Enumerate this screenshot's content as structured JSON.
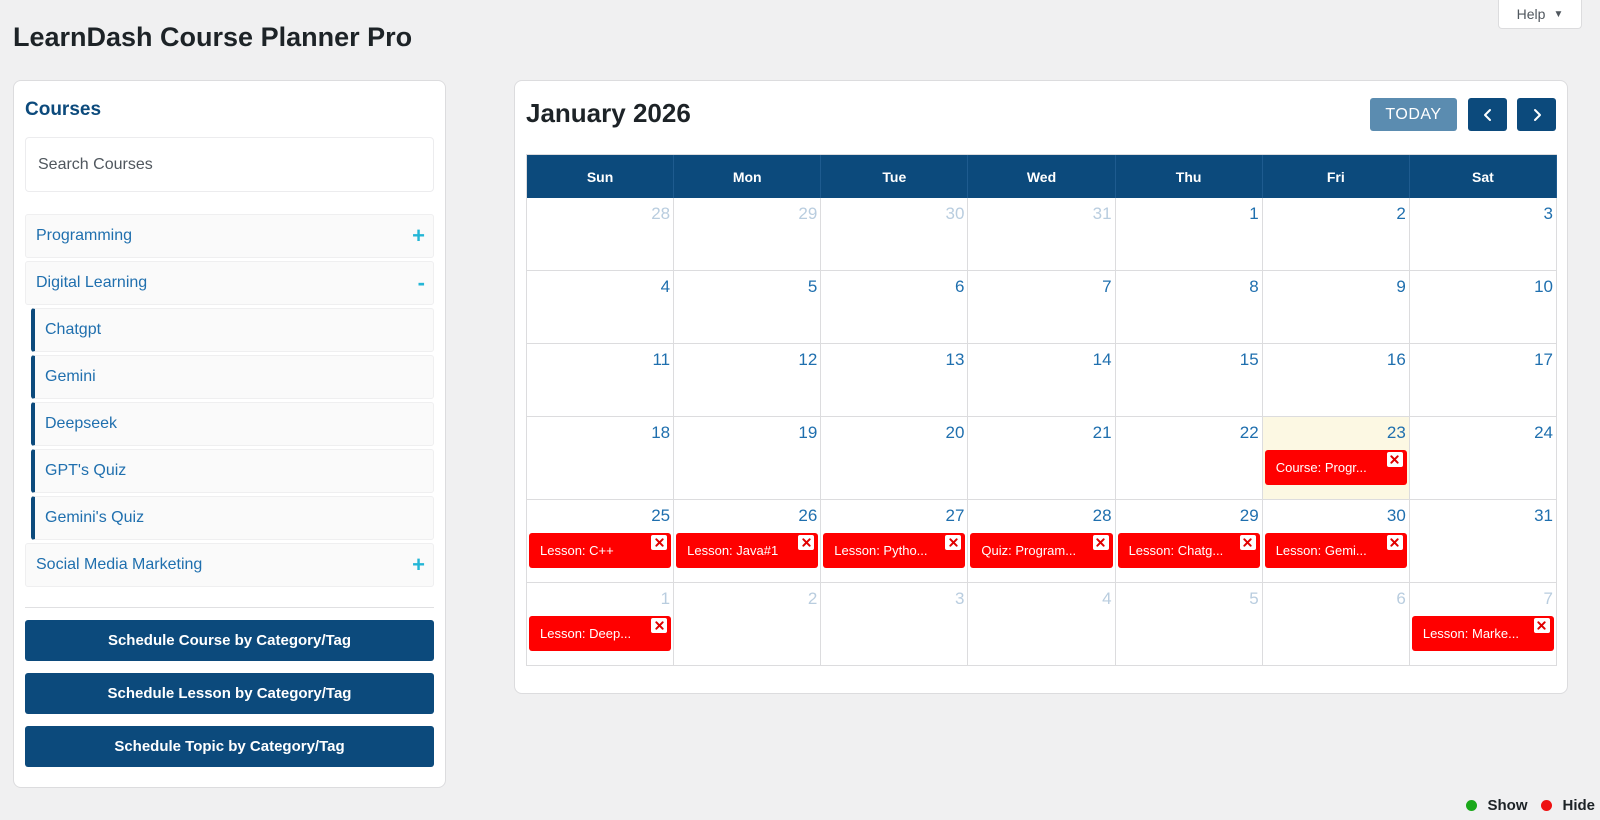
{
  "help": {
    "label": "Help",
    "caret": "▼"
  },
  "page": {
    "title": "LearnDash Course Planner Pro"
  },
  "sidebar": {
    "title": "Courses",
    "search_placeholder": "Search Courses",
    "categories": [
      {
        "label": "Programming",
        "toggle": "+",
        "expanded": false
      },
      {
        "label": "Digital Learning",
        "toggle": "-",
        "expanded": true,
        "items": [
          "Chatgpt",
          "Gemini",
          "Deepseek",
          "GPT's Quiz",
          "Gemini's Quiz"
        ]
      },
      {
        "label": "Social Media Marketing",
        "toggle": "+",
        "expanded": false
      }
    ],
    "buttons": [
      "Schedule Course by Category/Tag",
      "Schedule Lesson by Category/Tag",
      "Schedule Topic by Category/Tag"
    ]
  },
  "calendar": {
    "title": "January 2026",
    "today_label": "TODAY",
    "weekdays": [
      "Sun",
      "Mon",
      "Tue",
      "Wed",
      "Thu",
      "Fri",
      "Sat"
    ],
    "weeks": [
      [
        {
          "n": "28",
          "other": true
        },
        {
          "n": "29",
          "other": true
        },
        {
          "n": "30",
          "other": true
        },
        {
          "n": "31",
          "other": true
        },
        {
          "n": "1"
        },
        {
          "n": "2"
        },
        {
          "n": "3"
        }
      ],
      [
        {
          "n": "4"
        },
        {
          "n": "5"
        },
        {
          "n": "6"
        },
        {
          "n": "7"
        },
        {
          "n": "8"
        },
        {
          "n": "9"
        },
        {
          "n": "10"
        }
      ],
      [
        {
          "n": "11"
        },
        {
          "n": "12"
        },
        {
          "n": "13"
        },
        {
          "n": "14"
        },
        {
          "n": "15"
        },
        {
          "n": "16"
        },
        {
          "n": "17"
        }
      ],
      [
        {
          "n": "18"
        },
        {
          "n": "19"
        },
        {
          "n": "20"
        },
        {
          "n": "21"
        },
        {
          "n": "22"
        },
        {
          "n": "23",
          "today": true,
          "event": "Course: Progr..."
        },
        {
          "n": "24"
        }
      ],
      [
        {
          "n": "25",
          "event": "Lesson: C++"
        },
        {
          "n": "26",
          "event": "Lesson: Java#1"
        },
        {
          "n": "27",
          "event": "Lesson: Pytho..."
        },
        {
          "n": "28",
          "event": "Quiz: Program..."
        },
        {
          "n": "29",
          "event": "Lesson: Chatg..."
        },
        {
          "n": "30",
          "event": "Lesson: Gemi..."
        },
        {
          "n": "31"
        }
      ],
      [
        {
          "n": "1",
          "other": true,
          "event": "Lesson: Deep..."
        },
        {
          "n": "2",
          "other": true
        },
        {
          "n": "3",
          "other": true
        },
        {
          "n": "4",
          "other": true
        },
        {
          "n": "5",
          "other": true
        },
        {
          "n": "6",
          "other": true
        },
        {
          "n": "7",
          "other": true,
          "event": "Lesson: Marke..."
        }
      ]
    ],
    "event_color": "#ff0000",
    "header_color": "#0c4a7c",
    "today_bg": "#fcf8e3"
  },
  "legend": {
    "show": {
      "label": "Show",
      "color": "#1aa81a"
    },
    "hide": {
      "label": "Hide",
      "color": "#ee1111"
    }
  }
}
